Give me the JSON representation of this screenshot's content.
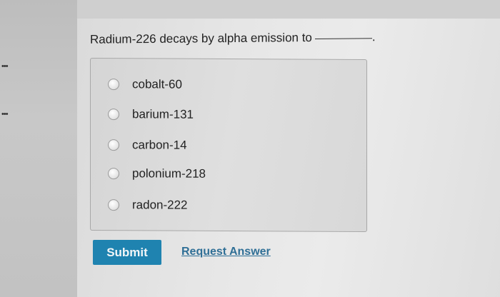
{
  "question": {
    "text": "Radium-226 decays by alpha emission to",
    "suffix": "."
  },
  "options": [
    {
      "label": "cobalt-60",
      "selected": false
    },
    {
      "label": "barium-131",
      "selected": false
    },
    {
      "label": "carbon-14",
      "selected": false
    },
    {
      "label": "polonium-218",
      "selected": false
    },
    {
      "label": "radon-222",
      "selected": false
    }
  ],
  "actions": {
    "submit_label": "Submit",
    "request_answer_label": "Request Answer"
  },
  "side": {
    "dots_glyph": "•••"
  },
  "colors": {
    "submit_bg": "#1f83b0",
    "link": "#2f6f96"
  }
}
